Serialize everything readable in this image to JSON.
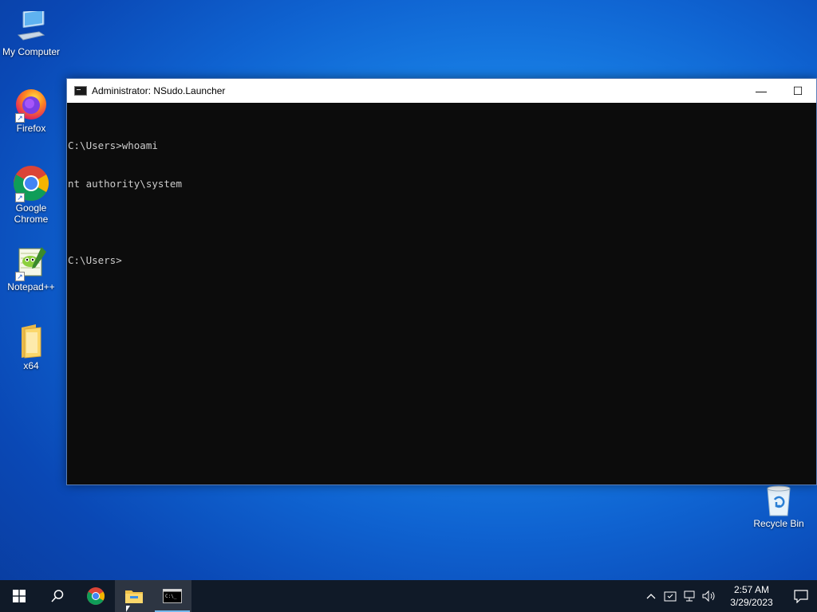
{
  "desktop": {
    "icons": [
      {
        "label": "My Computer",
        "icon": "monitor-icon"
      },
      {
        "label": "Firefox",
        "icon": "firefox-icon"
      },
      {
        "label": "Google Chrome",
        "icon": "chrome-icon"
      },
      {
        "label": "Notepad++",
        "icon": "notepadpp-icon"
      },
      {
        "label": "x64",
        "icon": "folder-icon"
      }
    ],
    "recycle_bin": {
      "label": "Recycle Bin",
      "icon": "recycle-bin-icon"
    }
  },
  "window": {
    "title": "Administrator: NSudo.Launcher",
    "minimize_glyph": "—",
    "maximize_glyph": "☐",
    "console_lines": [
      "C:\\Users>whoami",
      "nt authority\\system",
      "",
      "C:\\Users>"
    ]
  },
  "taskbar": {
    "items": [
      {
        "name": "start",
        "icon": "windows-logo-icon"
      },
      {
        "name": "search",
        "icon": "search-icon"
      },
      {
        "name": "chrome",
        "icon": "chrome-icon"
      },
      {
        "name": "file-explorer",
        "icon": "folder-icon"
      },
      {
        "name": "cmd",
        "icon": "terminal-icon"
      }
    ],
    "tray": {
      "time": "2:57 AM",
      "date": "3/29/2023"
    }
  },
  "colors": {
    "accent": "#76b9ed",
    "console_bg": "#0c0c0c",
    "console_fg": "#cccccc",
    "taskbar_bg": "#101a28"
  }
}
